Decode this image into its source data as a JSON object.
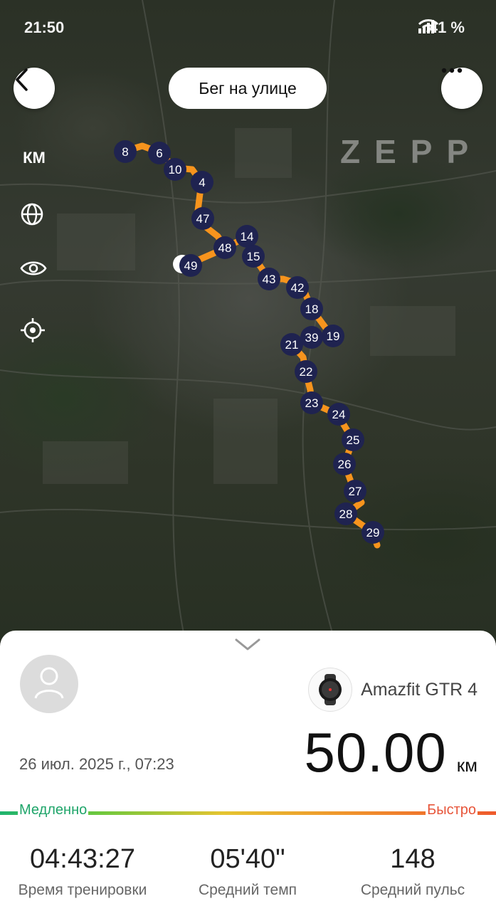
{
  "status_bar": {
    "time": "21:50",
    "battery": "41 %"
  },
  "header": {
    "title": "Бег на улице"
  },
  "map": {
    "watermark": "ZEPP",
    "tools": {
      "units_label": "КМ"
    },
    "markers": [
      "8",
      "6",
      "10",
      "4",
      "47",
      "14",
      "48",
      "15",
      "49",
      "43",
      "42",
      "18",
      "19",
      "21",
      "39",
      "22",
      "23",
      "24",
      "25",
      "26",
      "27",
      "28",
      "29"
    ],
    "route_color": "#f7941d",
    "marker_color": "#1f2350"
  },
  "summary": {
    "device_name": "Amazfit GTR 4",
    "date": "26 июл. 2025 г., 07:23",
    "distance": "50.00",
    "distance_unit": "км",
    "pace_scale": {
      "slow": "Медленно",
      "fast": "Быстро"
    },
    "stats": [
      {
        "value": "04:43:27",
        "label": "Время тренировки"
      },
      {
        "value": "05'40\"",
        "label": "Средний темп"
      },
      {
        "value": "148",
        "label": "Средний пульс"
      }
    ]
  }
}
